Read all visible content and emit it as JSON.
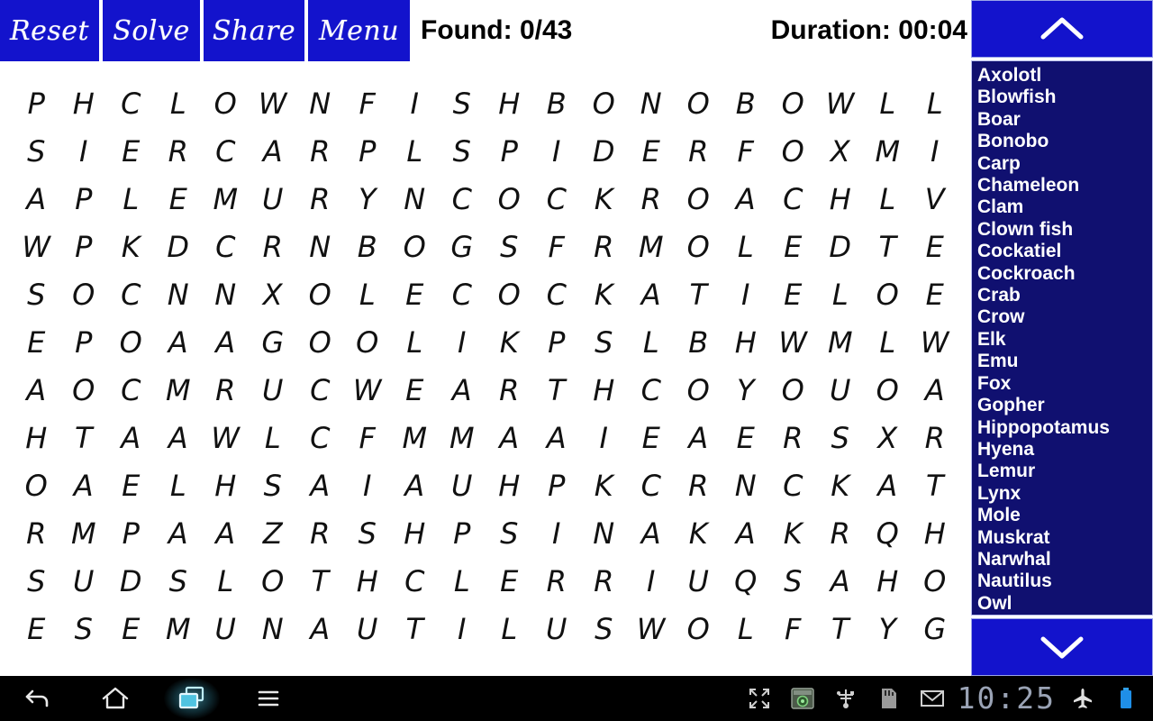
{
  "toolbar": {
    "reset_label": "Reset",
    "solve_label": "Solve",
    "share_label": "Share",
    "menu_label": "Menu",
    "found_label": "Found: 0/43",
    "duration_label": "Duration: 00:04",
    "button_color": "#1313cc"
  },
  "grid": {
    "rows": 12,
    "cols": 20,
    "letters": [
      [
        "P",
        "H",
        "C",
        "L",
        "O",
        "W",
        "N",
        "F",
        "I",
        "S",
        "H",
        "B",
        "O",
        "N",
        "O",
        "B",
        "O",
        "W",
        "L",
        "L"
      ],
      [
        "S",
        "I",
        "E",
        "R",
        "C",
        "A",
        "R",
        "P",
        "L",
        "S",
        "P",
        "I",
        "D",
        "E",
        "R",
        "F",
        "O",
        "X",
        "M",
        "I"
      ],
      [
        "A",
        "P",
        "L",
        "E",
        "M",
        "U",
        "R",
        "Y",
        "N",
        "C",
        "O",
        "C",
        "K",
        "R",
        "O",
        "A",
        "C",
        "H",
        "L",
        "V"
      ],
      [
        "W",
        "P",
        "K",
        "D",
        "C",
        "R",
        "N",
        "B",
        "O",
        "G",
        "S",
        "F",
        "R",
        "M",
        "O",
        "L",
        "E",
        "D",
        "T",
        "E"
      ],
      [
        "S",
        "O",
        "C",
        "N",
        "N",
        "X",
        "O",
        "L",
        "E",
        "C",
        "O",
        "C",
        "K",
        "A",
        "T",
        "I",
        "E",
        "L",
        "O",
        "E"
      ],
      [
        "E",
        "P",
        "O",
        "A",
        "A",
        "G",
        "O",
        "O",
        "L",
        "I",
        "K",
        "P",
        "S",
        "L",
        "B",
        "H",
        "W",
        "M",
        "L",
        "W"
      ],
      [
        "A",
        "O",
        "C",
        "M",
        "R",
        "U",
        "C",
        "W",
        "E",
        "A",
        "R",
        "T",
        "H",
        "C",
        "O",
        "Y",
        "O",
        "U",
        "O",
        "A"
      ],
      [
        "H",
        "T",
        "A",
        "A",
        "W",
        "L",
        "C",
        "F",
        "M",
        "M",
        "A",
        "A",
        "I",
        "E",
        "A",
        "E",
        "R",
        "S",
        "X",
        "R"
      ],
      [
        "O",
        "A",
        "E",
        "L",
        "H",
        "S",
        "A",
        "I",
        "A",
        "U",
        "H",
        "P",
        "K",
        "C",
        "R",
        "N",
        "C",
        "K",
        "A",
        "T"
      ],
      [
        "R",
        "M",
        "P",
        "A",
        "A",
        "Z",
        "R",
        "S",
        "H",
        "P",
        "S",
        "I",
        "N",
        "A",
        "K",
        "A",
        "K",
        "R",
        "Q",
        "H"
      ],
      [
        "S",
        "U",
        "D",
        "S",
        "L",
        "O",
        "T",
        "H",
        "C",
        "L",
        "E",
        "R",
        "R",
        "I",
        "U",
        "Q",
        "S",
        "A",
        "H",
        "O"
      ],
      [
        "E",
        "S",
        "E",
        "M",
        "U",
        "N",
        "A",
        "U",
        "T",
        "I",
        "L",
        "U",
        "S",
        "W",
        "O",
        "L",
        "F",
        "T",
        "Y",
        "G"
      ]
    ]
  },
  "sidebar": {
    "scroll_up_icon": "chevron-up-icon",
    "scroll_down_icon": "chevron-down-icon",
    "background_color": "#101070",
    "words": [
      "Axolotl",
      "Blowfish",
      "Boar",
      "Bonobo",
      "Carp",
      "Chameleon",
      "Clam",
      "Clown fish",
      "Cockatiel",
      "Cockroach",
      "Crab",
      "Crow",
      "Elk",
      "Emu",
      "Fox",
      "Gopher",
      "Hippopotamus",
      "Hyena",
      "Lemur",
      "Lynx",
      "Mole",
      "Muskrat",
      "Narwhal",
      "Nautilus",
      "Owl"
    ]
  },
  "navbar": {
    "back_icon": "back-arrow-icon",
    "home_icon": "home-icon",
    "recents_icon": "recent-apps-icon",
    "menu_icon": "menu-hamburger-icon",
    "status_icons": [
      "fullscreen-icon",
      "screenshot-app-icon",
      "usb-debug-icon",
      "sd-card-icon",
      "mail-icon"
    ],
    "clock": "10:25",
    "airplane_icon": "airplane-mode-icon",
    "battery_icon": "battery-icon",
    "battery_color": "#1f8fe8"
  }
}
